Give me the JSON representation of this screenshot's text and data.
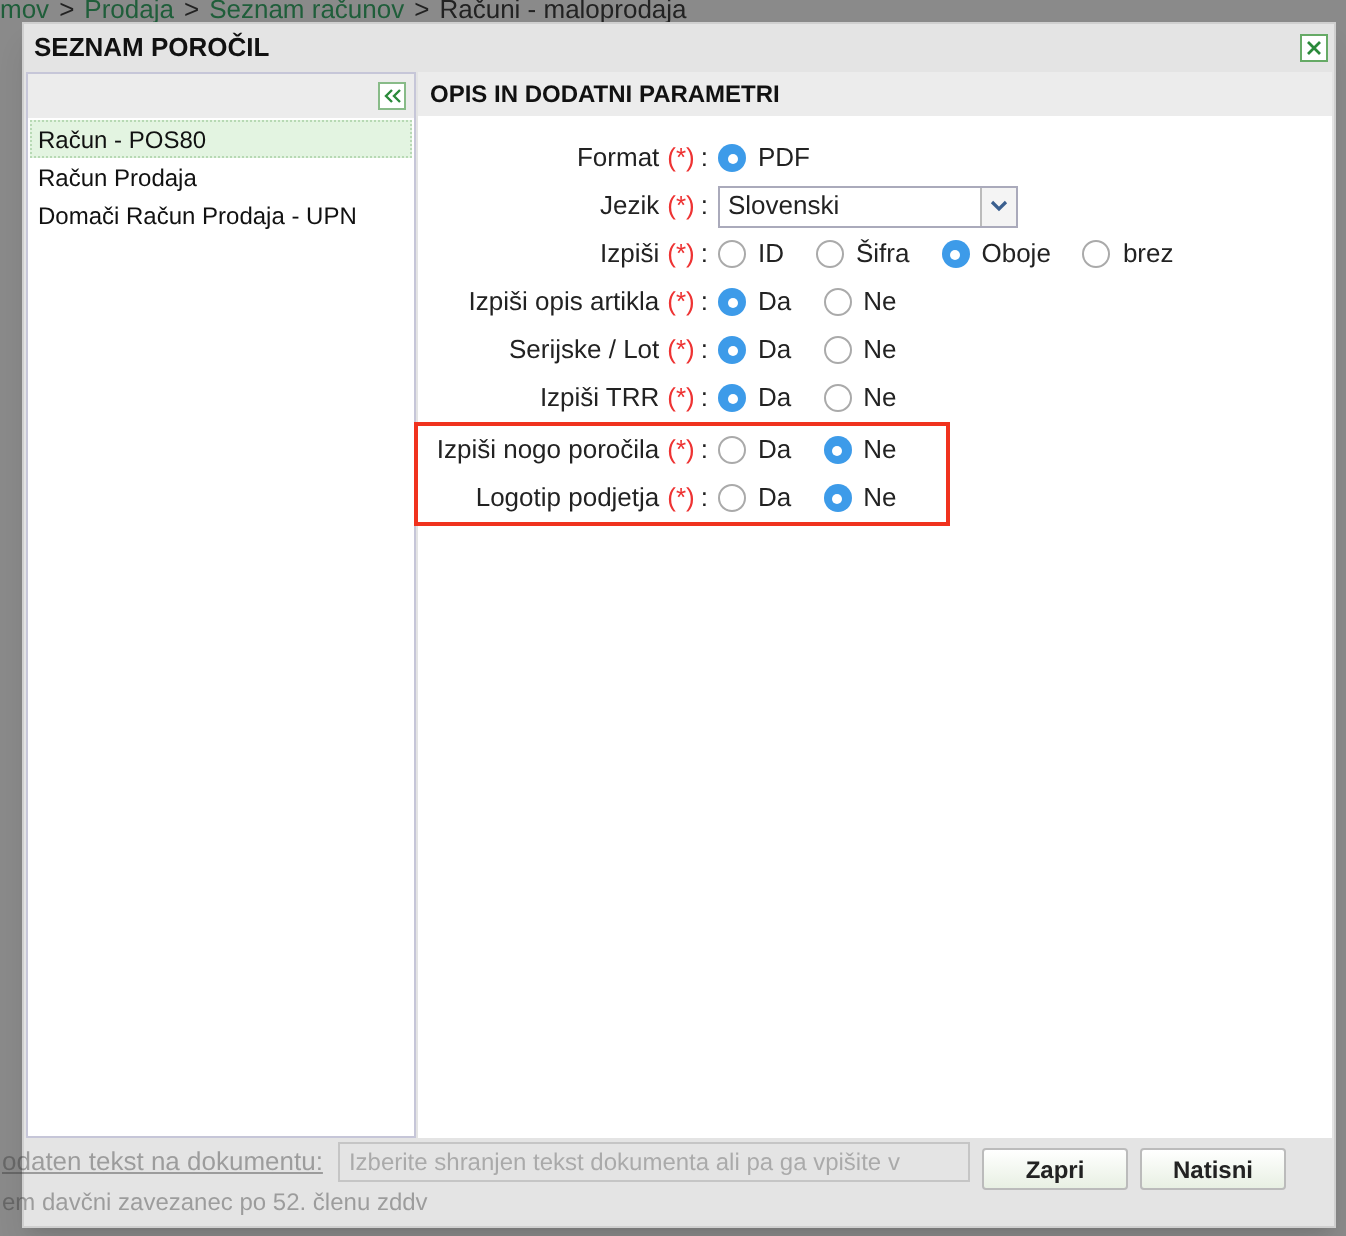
{
  "background": {
    "breadcrumb": [
      "mov",
      "Prodaja",
      "Seznam računov",
      "Računi - maloprodaja"
    ],
    "breadcrumb_separator": ">",
    "note_label": "odaten tekst na dokumentu:",
    "note_placeholder": "Izberite shranjen tekst dokumenta ali pa ga vpišite v",
    "footer_text": "em davčni zavezanec po 52. členu zddv"
  },
  "dialog": {
    "title": "SEZNAM POROČIL",
    "reports": [
      {
        "label": "Račun - POS80",
        "selected": true
      },
      {
        "label": "Račun Prodaja",
        "selected": false
      },
      {
        "label": "Domači Račun Prodaja - UPN",
        "selected": false
      }
    ],
    "panel_title": "OPIS IN DODATNI PARAMETRI",
    "required_mark": "(*)",
    "label_separator": ":",
    "fields": [
      {
        "kind": "radio",
        "label": "Format",
        "options": [
          {
            "label": "PDF",
            "selected": true
          }
        ]
      },
      {
        "kind": "select",
        "label": "Jezik",
        "value": "Slovenski"
      },
      {
        "kind": "radio",
        "label": "Izpiši",
        "options": [
          {
            "label": "ID",
            "selected": false
          },
          {
            "label": "Šifra",
            "selected": false
          },
          {
            "label": "Oboje",
            "selected": true
          },
          {
            "label": "brez",
            "selected": false
          }
        ]
      },
      {
        "kind": "radio",
        "label": "Izpiši opis artikla",
        "options": [
          {
            "label": "Da",
            "selected": true
          },
          {
            "label": "Ne",
            "selected": false
          }
        ]
      },
      {
        "kind": "radio",
        "label": "Serijske / Lot",
        "options": [
          {
            "label": "Da",
            "selected": true
          },
          {
            "label": "Ne",
            "selected": false
          }
        ]
      },
      {
        "kind": "radio",
        "label": "Izpiši TRR",
        "options": [
          {
            "label": "Da",
            "selected": true
          },
          {
            "label": "Ne",
            "selected": false
          }
        ]
      }
    ],
    "highlighted_fields": [
      {
        "kind": "radio",
        "label": "Izpiši nogo poročila",
        "options": [
          {
            "label": "Da",
            "selected": false
          },
          {
            "label": "Ne",
            "selected": true
          }
        ]
      },
      {
        "kind": "radio",
        "label": "Logotip podjetja",
        "options": [
          {
            "label": "Da",
            "selected": false
          },
          {
            "label": "Ne",
            "selected": true
          }
        ]
      }
    ],
    "buttons": [
      "Zapri",
      "Natisni"
    ]
  }
}
